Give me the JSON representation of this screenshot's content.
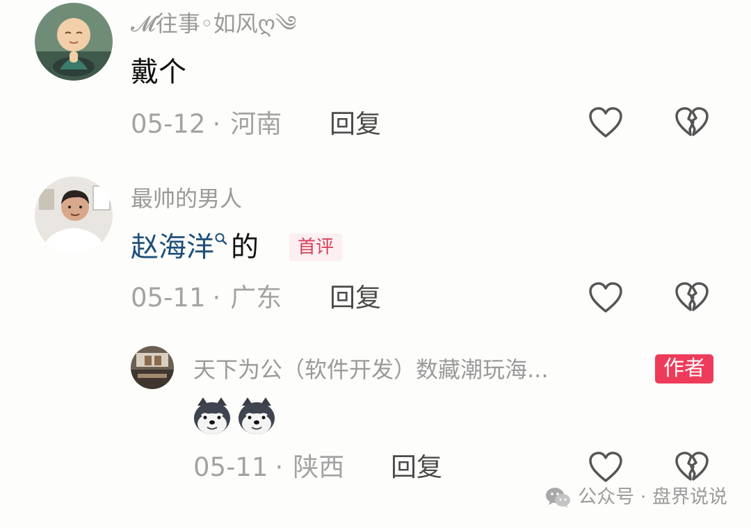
{
  "comments": [
    {
      "username": "𝓜往事◦如风ღ༄",
      "text": "戴个",
      "date": "05-12",
      "location": "河南",
      "reply_label": "回复"
    },
    {
      "username": "最帅的男人",
      "mention": "赵海洋",
      "text_suffix": "的",
      "badge": "首评",
      "date": "05-11",
      "location": "广东",
      "reply_label": "回复"
    }
  ],
  "reply": {
    "username": "天下为公（软件开发）数藏潮玩海...",
    "badge": "作者",
    "emojis": [
      "doge-husky",
      "doge-husky"
    ],
    "date": "05-11",
    "location": "陕西",
    "reply_label": "回复"
  },
  "watermark": {
    "text": "公众号 · 盘界说说",
    "icon": "wechat-icon"
  },
  "separator": "·",
  "colors": {
    "mention": "#1d4f7a",
    "badge_first_bg": "#fbeff1",
    "badge_first_fg": "#d8405a",
    "badge_author": "#ef3b5a"
  }
}
